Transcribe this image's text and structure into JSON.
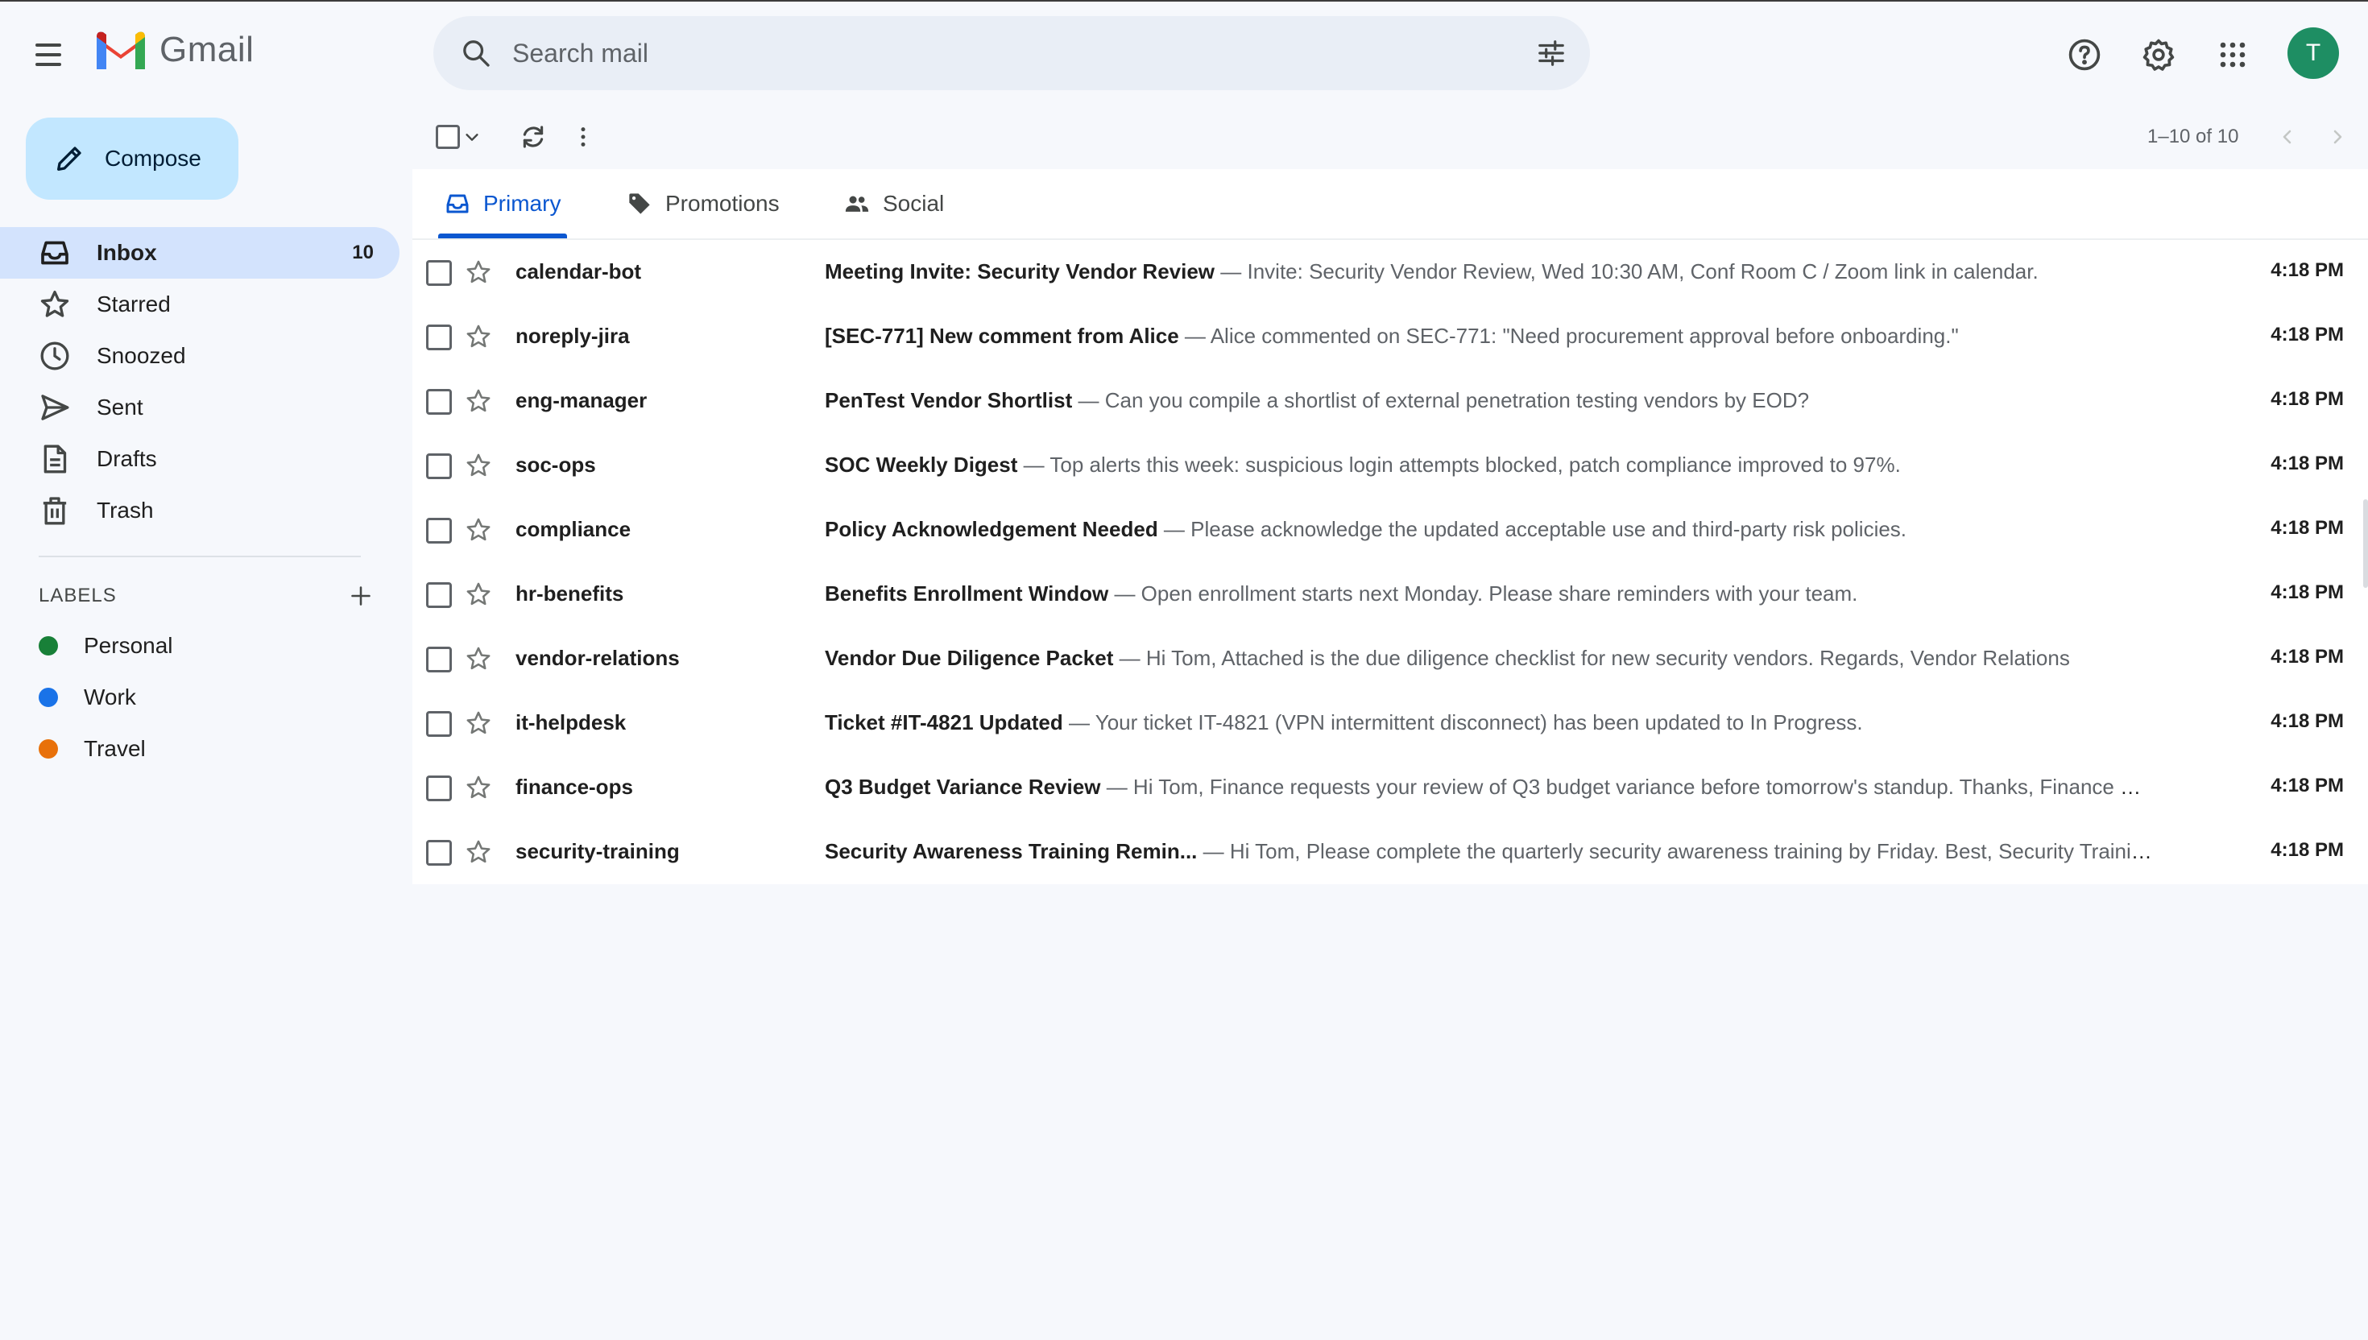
{
  "app": {
    "name": "Gmail"
  },
  "search": {
    "placeholder": "Search mail"
  },
  "account": {
    "initial": "T",
    "avatar_color": "#1e8e63"
  },
  "compose": {
    "label": "Compose"
  },
  "nav": [
    {
      "label": "Inbox",
      "count": "10",
      "icon": "inbox-icon",
      "active": true
    },
    {
      "label": "Starred",
      "icon": "star-icon"
    },
    {
      "label": "Snoozed",
      "icon": "clock-icon"
    },
    {
      "label": "Sent",
      "icon": "send-icon"
    },
    {
      "label": "Drafts",
      "icon": "draft-icon"
    },
    {
      "label": "Trash",
      "icon": "trash-icon"
    }
  ],
  "labels": {
    "header": "LABELS",
    "items": [
      {
        "name": "Personal",
        "color": "#188038"
      },
      {
        "name": "Work",
        "color": "#1a73e8"
      },
      {
        "name": "Travel",
        "color": "#e8710a"
      }
    ]
  },
  "toolbar": {
    "pagination": "1–10 of 10"
  },
  "tabs": [
    {
      "label": "Primary",
      "icon": "inbox-icon",
      "active": true
    },
    {
      "label": "Promotions",
      "icon": "tag-icon"
    },
    {
      "label": "Social",
      "icon": "people-icon"
    }
  ],
  "emails": [
    {
      "sender": "calendar-bot",
      "subject": "Meeting Invite: Security Vendor Review",
      "dash": " — ",
      "snippet": "Invite: Security Vendor Review, Wed 10:30 AM, Conf Room C / Zoom link in calendar.",
      "time": "4:18 PM"
    },
    {
      "sender": "noreply-jira",
      "subject": "[SEC-771] New comment from Alice",
      "dash": " — ",
      "snippet": "Alice commented on SEC-771: \"Need procurement approval before onboarding.\"",
      "time": "4:18 PM"
    },
    {
      "sender": "eng-manager",
      "subject": "PenTest Vendor Shortlist",
      "dash": " — ",
      "snippet": "Can you compile a shortlist of external penetration testing vendors by EOD?",
      "time": "4:18 PM"
    },
    {
      "sender": "soc-ops",
      "subject": "SOC Weekly Digest",
      "dash": " — ",
      "snippet": "Top alerts this week: suspicious login attempts blocked, patch compliance improved to 97%.",
      "time": "4:18 PM"
    },
    {
      "sender": "compliance",
      "subject": "Policy Acknowledgement Needed",
      "dash": " — ",
      "snippet": "Please acknowledge the updated acceptable use and third-party risk policies.",
      "time": "4:18 PM"
    },
    {
      "sender": "hr-benefits",
      "subject": "Benefits Enrollment Window",
      "dash": " — ",
      "snippet": "Open enrollment starts next Monday. Please share reminders with your team.",
      "time": "4:18 PM"
    },
    {
      "sender": "vendor-relations",
      "subject": "Vendor Due Diligence Packet",
      "dash": " — ",
      "snippet": "Hi Tom, Attached is the due diligence checklist for new security vendors. Regards, Vendor Relations",
      "time": "4:18 PM"
    },
    {
      "sender": "it-helpdesk",
      "subject": "Ticket #IT-4821 Updated",
      "dash": " — ",
      "snippet": "Your ticket IT-4821 (VPN intermittent disconnect) has been updated to In Progress.",
      "time": "4:18 PM"
    },
    {
      "sender": "finance-ops",
      "subject": "Q3 Budget Variance Review",
      "dash": " — ",
      "snippet": "Hi Tom, Finance requests your review of Q3 budget variance before tomorrow's standup. Thanks, Finance Ops",
      "time": "4:18 PM"
    },
    {
      "sender": "security-training",
      "subject": "Security Awareness Training Remin...",
      "dash": " — ",
      "snippet": "Hi Tom, Please complete the quarterly security awareness training by Friday. Best, Security Training T...",
      "time": "4:18 PM"
    }
  ]
}
